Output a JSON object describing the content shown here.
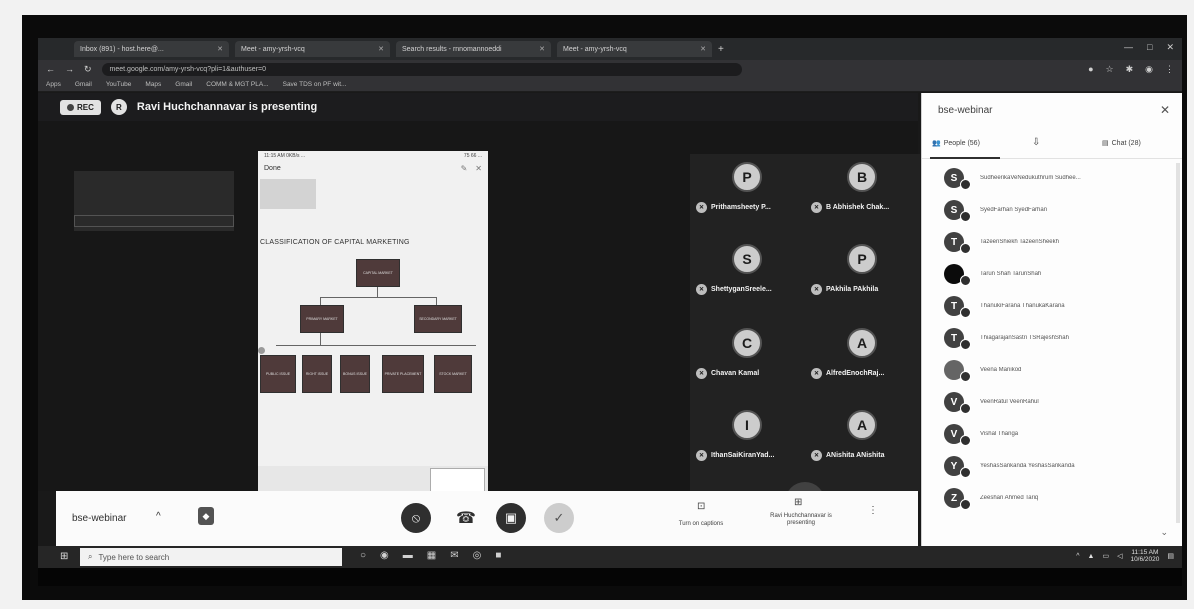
{
  "browser": {
    "tabs": [
      {
        "label": "Inbox (891) - host.here@..."
      },
      {
        "label": "Meet - amy-yrsh-vcq"
      },
      {
        "label": "Search results - rnnomannoeddi"
      },
      {
        "label": "Meet - amy-yrsh-vcq"
      }
    ],
    "url": "meet.google.com/amy-yrsh-vcq?pli=1&authuser=0",
    "bookmarks": [
      "Apps",
      "Gmail",
      "YouTube",
      "Maps",
      "Gmail",
      "COMM & MGT PLA...",
      "Save TDS on PF wit..."
    ]
  },
  "meet": {
    "rec_label": "REC",
    "presenter_initial": "R",
    "presenting_text": "Ravi Huchchannavar is presenting",
    "meeting_name": "bse-webinar",
    "captions_label": "Turn on captions",
    "presenting_label": "Ravi Huchchannavar is presenting"
  },
  "shared_screen": {
    "status_left": "11:15 AM  0KB/s  ...",
    "status_right": "75  66  ...",
    "done_label": "Done",
    "title": "CLASSIFICATION OF CAPITAL MARKETING",
    "root_box": "CAPITAL MARKET",
    "level2": [
      "PRIMARY MARKET",
      "SECONDARY MARKET"
    ],
    "level3": [
      "PUBLIC ISSUE",
      "RIGHT ISSUE",
      "BONUS ISSUE",
      "PRIVATE PLACEMENT",
      "STOCK MARKET"
    ]
  },
  "tiles": [
    {
      "initial": "P",
      "name": "Prithamsheety P..."
    },
    {
      "initial": "B",
      "name": "B Abhishek Chak..."
    },
    {
      "initial": "S",
      "name": "ShettyganSreele..."
    },
    {
      "initial": "P",
      "name": "PAkhila PAkhila"
    },
    {
      "initial": "C",
      "name": "Chavan Kamal"
    },
    {
      "initial": "A",
      "name": "AlfredEnochRaj..."
    },
    {
      "initial": "I",
      "name": "IthanSaiKiranYad..."
    },
    {
      "initial": "A",
      "name": "ANishita ANishita"
    }
  ],
  "panel": {
    "title": "bse-webinar",
    "people_tab": "People (56)",
    "chat_tab": "Chat (28)",
    "participants": [
      {
        "initial": "S",
        "name": "SudheerikaVeNedukuthrum Sudhee..."
      },
      {
        "initial": "S",
        "name": "SyedFarhan SyedFarhan"
      },
      {
        "initial": "T",
        "name": "TazeenShiekh TazeenSheekh"
      },
      {
        "initial": "",
        "name": "Tarun Shah TarunShah"
      },
      {
        "initial": "T",
        "name": "ThanukiFarana ThanukaKarana"
      },
      {
        "initial": "T",
        "name": "ThiagarajanSastri TSRajeshShah"
      },
      {
        "initial": "",
        "name": "Veena Manikod"
      },
      {
        "initial": "V",
        "name": "VeenRatul VeenRahul"
      },
      {
        "initial": "V",
        "name": "Vishal Thanga"
      },
      {
        "initial": "Y",
        "name": "YeshasSankanda YeshasSankanda"
      },
      {
        "initial": "Z",
        "name": "Zeeshan Ahmed Tariq"
      }
    ]
  },
  "taskbar": {
    "search_placeholder": "Type here to search",
    "time": "11:15 AM",
    "date": "10/6/2020"
  }
}
